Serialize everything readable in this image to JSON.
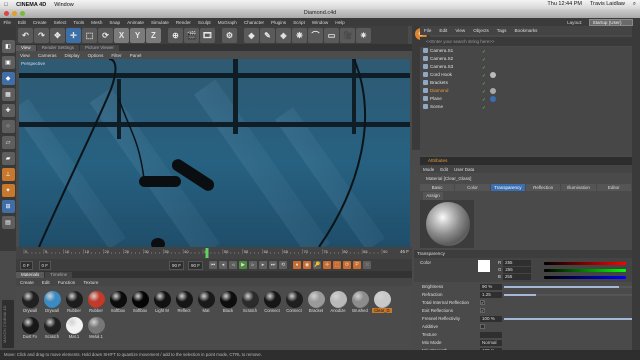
{
  "macbar": {
    "app": "CINEMA 4D",
    "menu": "Window",
    "clock": "Thu 12:44 PM",
    "user": "Travis Laidlaw"
  },
  "window": {
    "title": "Diamond.c4d"
  },
  "appmenu": {
    "items": [
      "File",
      "Edit",
      "Create",
      "Select",
      "Tools",
      "Mesh",
      "Snap",
      "Animate",
      "Simulate",
      "Render",
      "Sculpt",
      "MoGraph",
      "Character",
      "Plugins",
      "Script",
      "Window",
      "Help"
    ],
    "layout_label": "Layout:",
    "layout_value": "Startup (User)"
  },
  "toolbar": {
    "icons": [
      "undo-icon",
      "redo-icon",
      "live-select-icon",
      "move-icon",
      "scale-icon",
      "rotate-icon",
      "x-axis-icon",
      "y-axis-icon",
      "z-axis-icon",
      "coord-system-icon",
      "render-view-icon",
      "render-pv-icon",
      "render-settings-icon",
      "cube-icon",
      "pen-icon",
      "subdivision-icon",
      "array-icon",
      "deformer-icon",
      "floor-icon",
      "camera-icon",
      "light-icon"
    ],
    "glyphs": [
      "↶",
      "↷",
      "✥",
      "✛",
      "⬚",
      "⟳",
      "X",
      "Y",
      "Z",
      "⊕",
      "🎬",
      "🎞",
      "⚙",
      "◆",
      "✎",
      "◈",
      "❋",
      "⌒",
      "▭",
      "🎥",
      "✷"
    ]
  },
  "viewport": {
    "tabs": [
      "View",
      "Render Settings",
      "Picture Viewer"
    ],
    "menu": [
      "View",
      "Cameras",
      "Display",
      "Options",
      "Filter",
      "Panel"
    ],
    "label": "Perspective"
  },
  "timeline": {
    "ticks": [
      "0",
      "5",
      "10",
      "15",
      "20",
      "25",
      "30",
      "35",
      "40",
      "45",
      "50",
      "55",
      "60",
      "65",
      "70",
      "75",
      "80",
      "85",
      "90"
    ],
    "end_label": "46 F",
    "current_frame": 46,
    "start_field": "0 F",
    "min_field": "0 F",
    "end_field": "90 F",
    "max_field": "90 F"
  },
  "materials": {
    "tabs": [
      "Materials",
      "Timeline"
    ],
    "menu": [
      "Create",
      "Edit",
      "Function",
      "Texture"
    ],
    "items": [
      {
        "label": "Drywall",
        "color": "#202020"
      },
      {
        "label": "Drywall",
        "color": "#3a8ac4"
      },
      {
        "label": "Rubber",
        "color": "#1d1d1d"
      },
      {
        "label": "Rubber",
        "color": "#c33a2a"
      },
      {
        "label": "Softbox",
        "color": "#0c0c0c"
      },
      {
        "label": "Softbox",
        "color": "#050505"
      },
      {
        "label": "Light M",
        "color": "#111111"
      },
      {
        "label": "Reflect",
        "color": "#161616"
      },
      {
        "label": "Mat",
        "color": "#1a1a1a"
      },
      {
        "label": "Black",
        "color": "#0d0d0d"
      },
      {
        "label": "Scratch",
        "color": "#2b2b2b"
      },
      {
        "label": "Connect",
        "color": "#161616"
      },
      {
        "label": "Connect",
        "color": "#1f1f1f"
      },
      {
        "label": "Bracket",
        "color": "#9a9a9a"
      },
      {
        "label": "Anodize",
        "color": "#b9b9b9"
      },
      {
        "label": "Brushed",
        "color": "#8c8c8c"
      },
      {
        "label": "Clear_G",
        "color": "#c8c8c8",
        "selected": true
      },
      {
        "label": "Dust Fx",
        "color": "#181818"
      },
      {
        "label": "Scratch",
        "color": "#202020"
      },
      {
        "label": "Mat.1",
        "color": "#f2f2f2"
      },
      {
        "label": "Metal.1",
        "color": "#777777"
      }
    ]
  },
  "maxon": "MAXON CINEMA 4D",
  "status": "Move: Click and drag to move elements. Hold down SHIFT to quantize movement / add to the selection in point mode, CTRL to remove.",
  "objects": {
    "menu": [
      "File",
      "Edit",
      "View",
      "Objects",
      "Tags",
      "Bookmarks"
    ],
    "search_placeholder": "<<Enter your search string here>>",
    "rows": [
      {
        "name": "Camera.S1"
      },
      {
        "name": "Camera.S2"
      },
      {
        "name": "Camera.S3"
      },
      {
        "name": "Cord Hook"
      },
      {
        "name": "Brackets"
      },
      {
        "name": "Diamond",
        "selected": true
      },
      {
        "name": "Plane"
      },
      {
        "name": "Scene"
      }
    ]
  },
  "attributes": {
    "header": "Attributes",
    "menu": [
      "Mode",
      "Edit",
      "User Data"
    ],
    "title": "Material [Clear_Glass]",
    "tabs": [
      "Basic",
      "Color",
      "Transparency",
      "Reflection",
      "Illumination",
      "Editor"
    ],
    "active_tab": "Transparency",
    "assign": "Assign",
    "section": "Transparency",
    "color_label": "Color",
    "rgb": [
      {
        "ch": "R",
        "val": "255"
      },
      {
        "ch": "G",
        "val": "255"
      },
      {
        "ch": "B",
        "val": "255"
      }
    ],
    "params": [
      {
        "label": "Brightness",
        "value": "90 %",
        "fill": 0.9
      },
      {
        "label": "Refraction",
        "value": "1.25",
        "fill": 0.25
      },
      {
        "label": "Total Internal Reflection",
        "check": "✓"
      },
      {
        "label": "Exit Reflections",
        "check": "✓"
      },
      {
        "label": "Fresnel Reflectivity",
        "value": "100 %",
        "fill": 1.0
      },
      {
        "label": "Additive",
        "check": ""
      },
      {
        "label": "Texture",
        "value": ""
      },
      {
        "label": "Mix Mode",
        "value": "Normal"
      },
      {
        "label": "Mix Strength",
        "value": "100 %"
      }
    ]
  }
}
